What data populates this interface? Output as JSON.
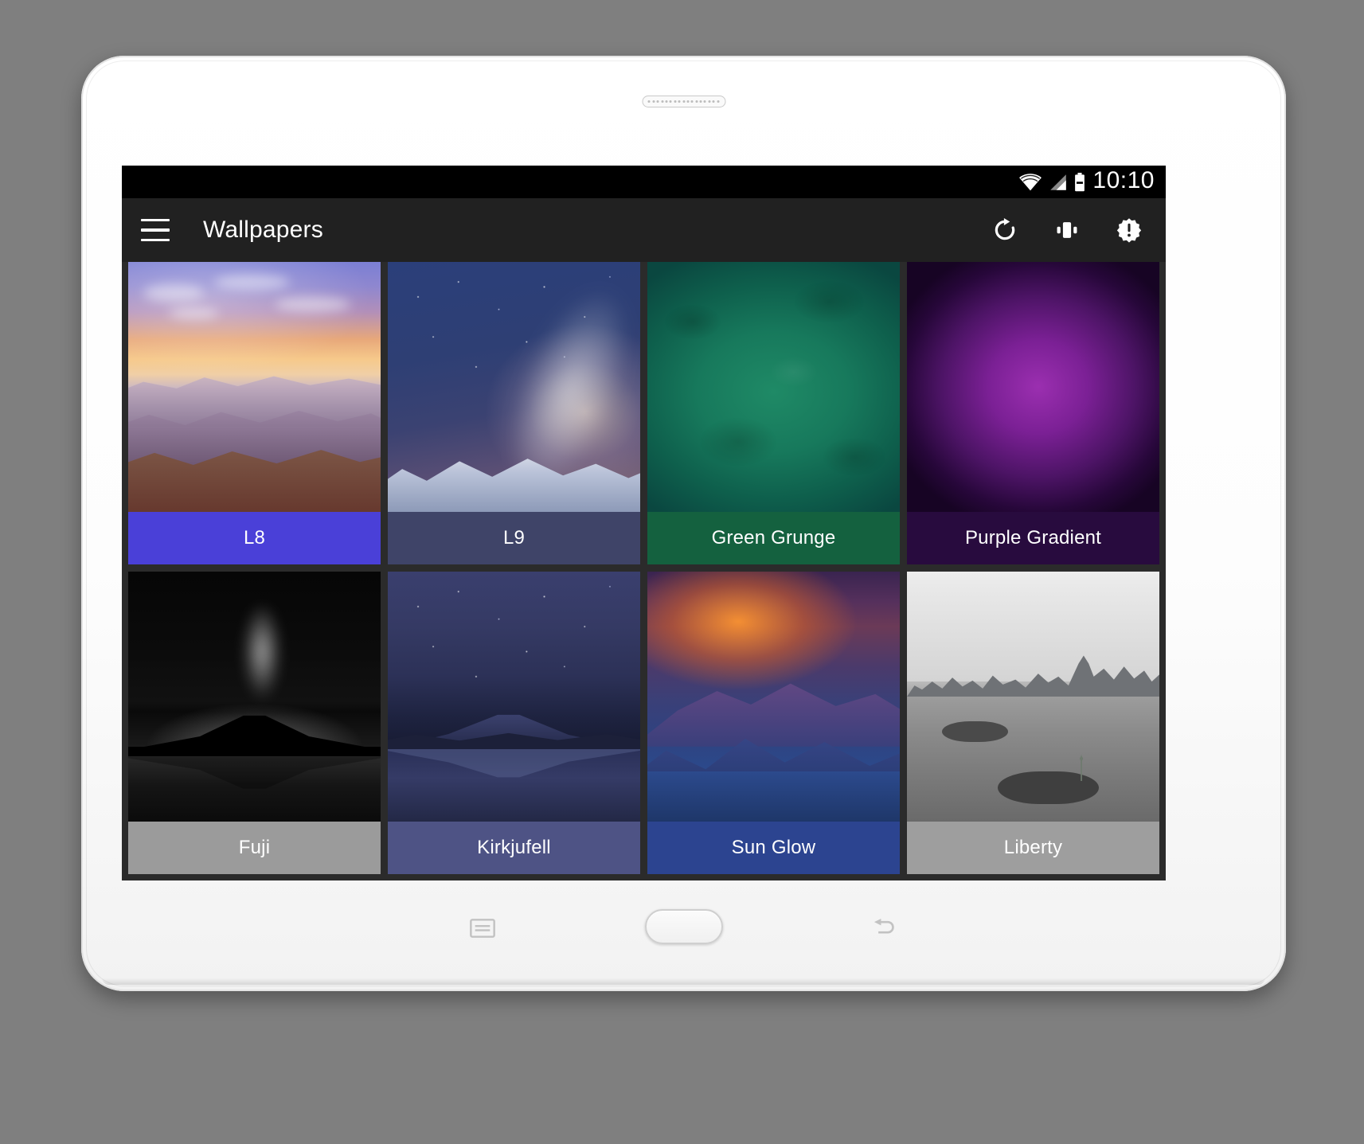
{
  "status_bar": {
    "time": "10:10",
    "icons": [
      "wifi-icon",
      "signal-icon",
      "battery-icon"
    ]
  },
  "toolbar": {
    "menu_icon": "hamburger-menu-icon",
    "title": "Wallpapers",
    "actions": [
      {
        "name": "refresh-button",
        "icon": "refresh-icon"
      },
      {
        "name": "preview-button",
        "icon": "phone-vibrate-icon"
      },
      {
        "name": "about-button",
        "icon": "alert-badge-icon"
      }
    ]
  },
  "grid": {
    "items": [
      {
        "label": "L8",
        "art": "canyon",
        "caption_color": "#4a40d8"
      },
      {
        "label": "L9",
        "art": "milky",
        "caption_color": "#3f4468"
      },
      {
        "label": "Green Grunge",
        "art": "green",
        "caption_color": "#14613f"
      },
      {
        "label": "Purple Gradient",
        "art": "purple",
        "caption_color": "#280b3e"
      },
      {
        "label": "Fuji",
        "art": "fuji",
        "caption_color": "#9b9b9b"
      },
      {
        "label": "Kirkjufell",
        "art": "kirk",
        "caption_color": "#4e5385"
      },
      {
        "label": "Sun Glow",
        "art": "sun",
        "caption_color": "#2c4490"
      },
      {
        "label": "Liberty",
        "art": "liberty",
        "caption_color": "#9e9e9e"
      }
    ]
  },
  "hardware_keys": [
    {
      "name": "recent-apps-key",
      "icon": "recent-apps-icon"
    },
    {
      "name": "home-key",
      "icon": "home-button-icon"
    },
    {
      "name": "back-key",
      "icon": "back-arrow-icon"
    }
  ],
  "colors": {
    "toolbar_bg": "#212121",
    "status_bar_bg": "#000000",
    "grid_bg": "#2b2b2b",
    "bezel": "#ffffff",
    "page_bg": "#7f7f7f"
  }
}
